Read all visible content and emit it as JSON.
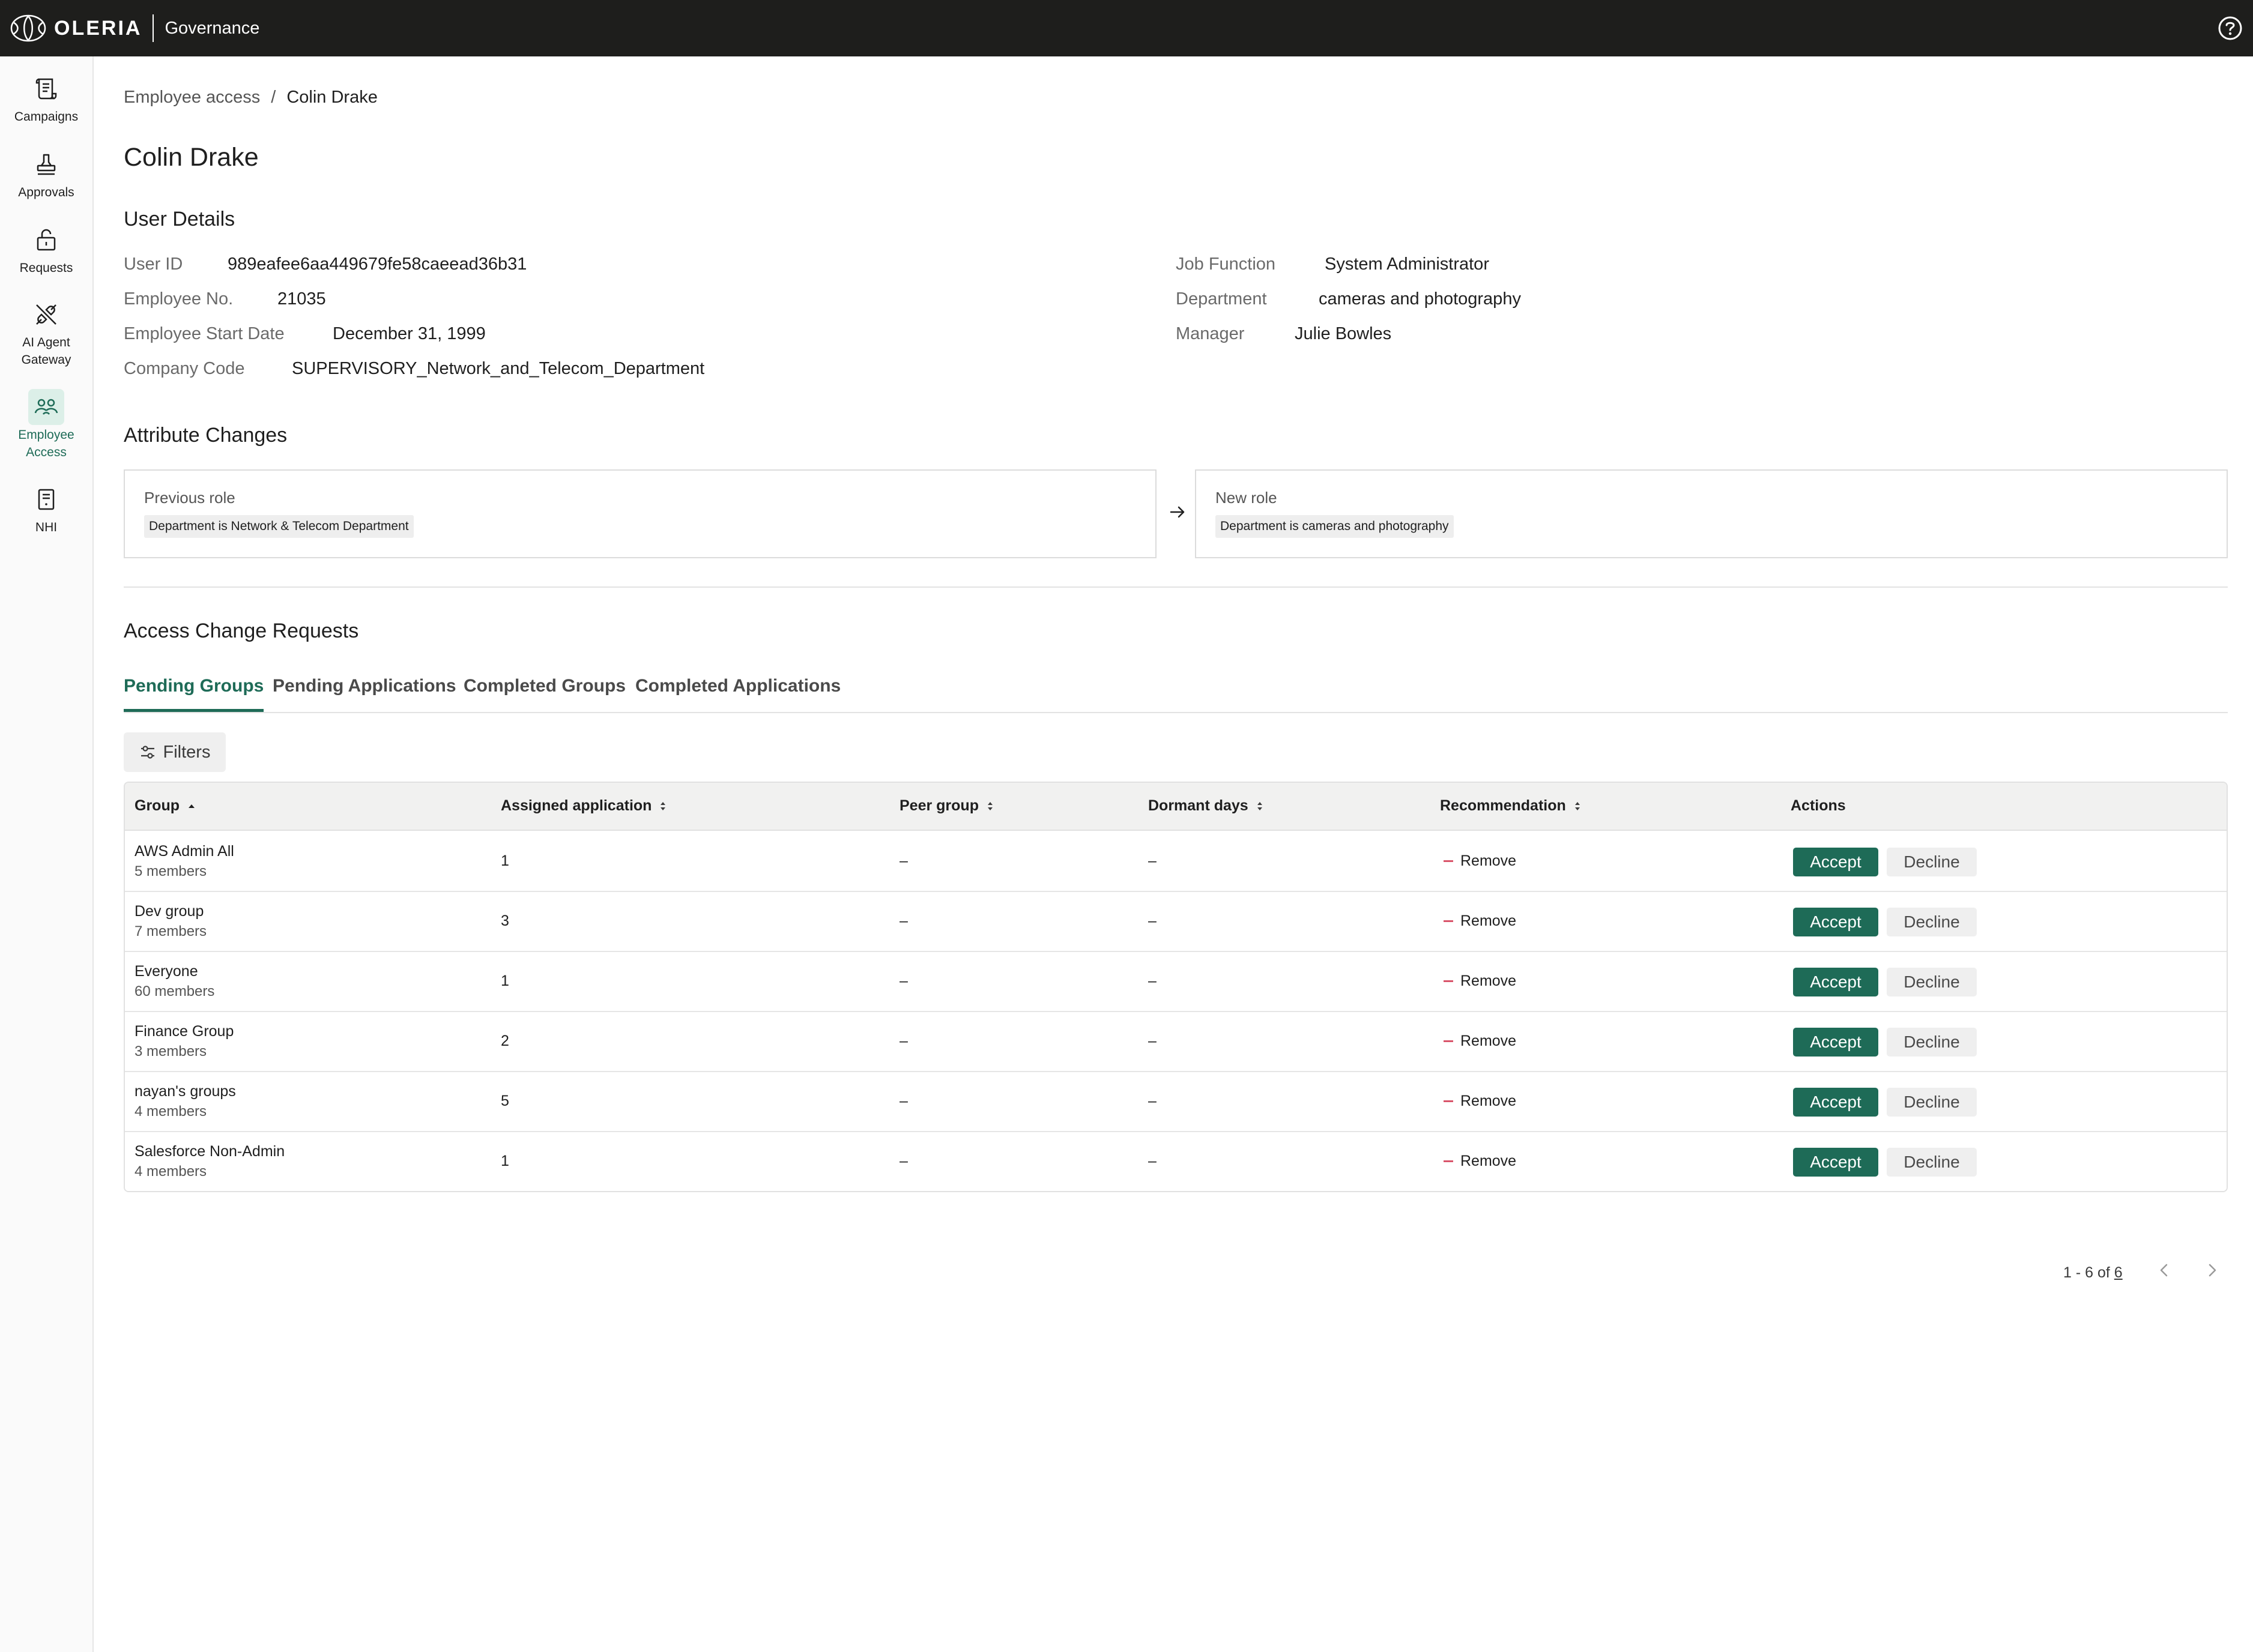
{
  "app": {
    "logo_text": "OLERIA",
    "product": "Governance"
  },
  "sidebar": {
    "items": [
      {
        "label": "Campaigns",
        "icon": "scroll-icon",
        "active": false
      },
      {
        "label": "Approvals",
        "icon": "stamp-icon",
        "active": false
      },
      {
        "label": "Requests",
        "icon": "unlock-icon",
        "active": false
      },
      {
        "label": "AI Agent Gateway",
        "icon": "plug-disconnected-icon",
        "active": false
      },
      {
        "label": "Employee Access",
        "icon": "people-icon",
        "active": true
      },
      {
        "label": "NHI",
        "icon": "document-icon",
        "active": false
      }
    ]
  },
  "breadcrumb": {
    "parent": "Employee access",
    "separator": "/",
    "current": "Colin Drake"
  },
  "page_title": "Colin Drake",
  "user_details": {
    "title": "User Details",
    "user_id_label": "User ID",
    "user_id": "989eafee6aa449679fe58caeead36b31",
    "employee_no_label": "Employee No.",
    "employee_no": "21035",
    "start_date_label": "Employee Start Date",
    "start_date": "December 31, 1999",
    "company_code_label": "Company Code",
    "company_code": "SUPERVISORY_Network_and_Telecom_Department",
    "job_function_label": "Job Function",
    "job_function": "System Administrator",
    "department_label": "Department",
    "department": "cameras and photography",
    "manager_label": "Manager",
    "manager": "Julie Bowles"
  },
  "attribute_changes": {
    "title": "Attribute Changes",
    "previous_label": "Previous role",
    "previous_value": "Department is Network & Telecom Department",
    "new_label": "New role",
    "new_value": "Department is cameras and photography"
  },
  "access_requests": {
    "title": "Access Change Requests",
    "tabs": [
      {
        "label": "Pending Groups",
        "active": true
      },
      {
        "label": "Pending Applications",
        "active": false
      },
      {
        "label": "Completed Groups",
        "active": false
      },
      {
        "label": "Completed Applications",
        "active": false
      }
    ],
    "filters_label": "Filters",
    "columns": {
      "group": "Group",
      "assigned_application": "Assigned application",
      "peer_group": "Peer group",
      "dormant_days": "Dormant days",
      "recommendation": "Recommendation",
      "actions": "Actions"
    },
    "accept_label": "Accept",
    "decline_label": "Decline",
    "rows": [
      {
        "group": "AWS Admin All",
        "members": "5 members",
        "assigned": "1",
        "peer": "–",
        "dormant": "–",
        "recommendation": "Remove"
      },
      {
        "group": "Dev group",
        "members": "7 members",
        "assigned": "3",
        "peer": "–",
        "dormant": "–",
        "recommendation": "Remove"
      },
      {
        "group": "Everyone",
        "members": "60 members",
        "assigned": "1",
        "peer": "–",
        "dormant": "–",
        "recommendation": "Remove"
      },
      {
        "group": "Finance Group",
        "members": "3 members",
        "assigned": "2",
        "peer": "–",
        "dormant": "–",
        "recommendation": "Remove"
      },
      {
        "group": "nayan's groups",
        "members": "4 members",
        "assigned": "5",
        "peer": "–",
        "dormant": "–",
        "recommendation": "Remove"
      },
      {
        "group": "Salesforce Non-Admin",
        "members": "4 members",
        "assigned": "1",
        "peer": "–",
        "dormant": "–",
        "recommendation": "Remove"
      }
    ],
    "pagination": {
      "range": "1 - 6 of",
      "total": "6"
    }
  },
  "colors": {
    "accent": "#1e6b57",
    "topbar": "#1e1e1c",
    "recommendation_dash": "#d9546a"
  }
}
